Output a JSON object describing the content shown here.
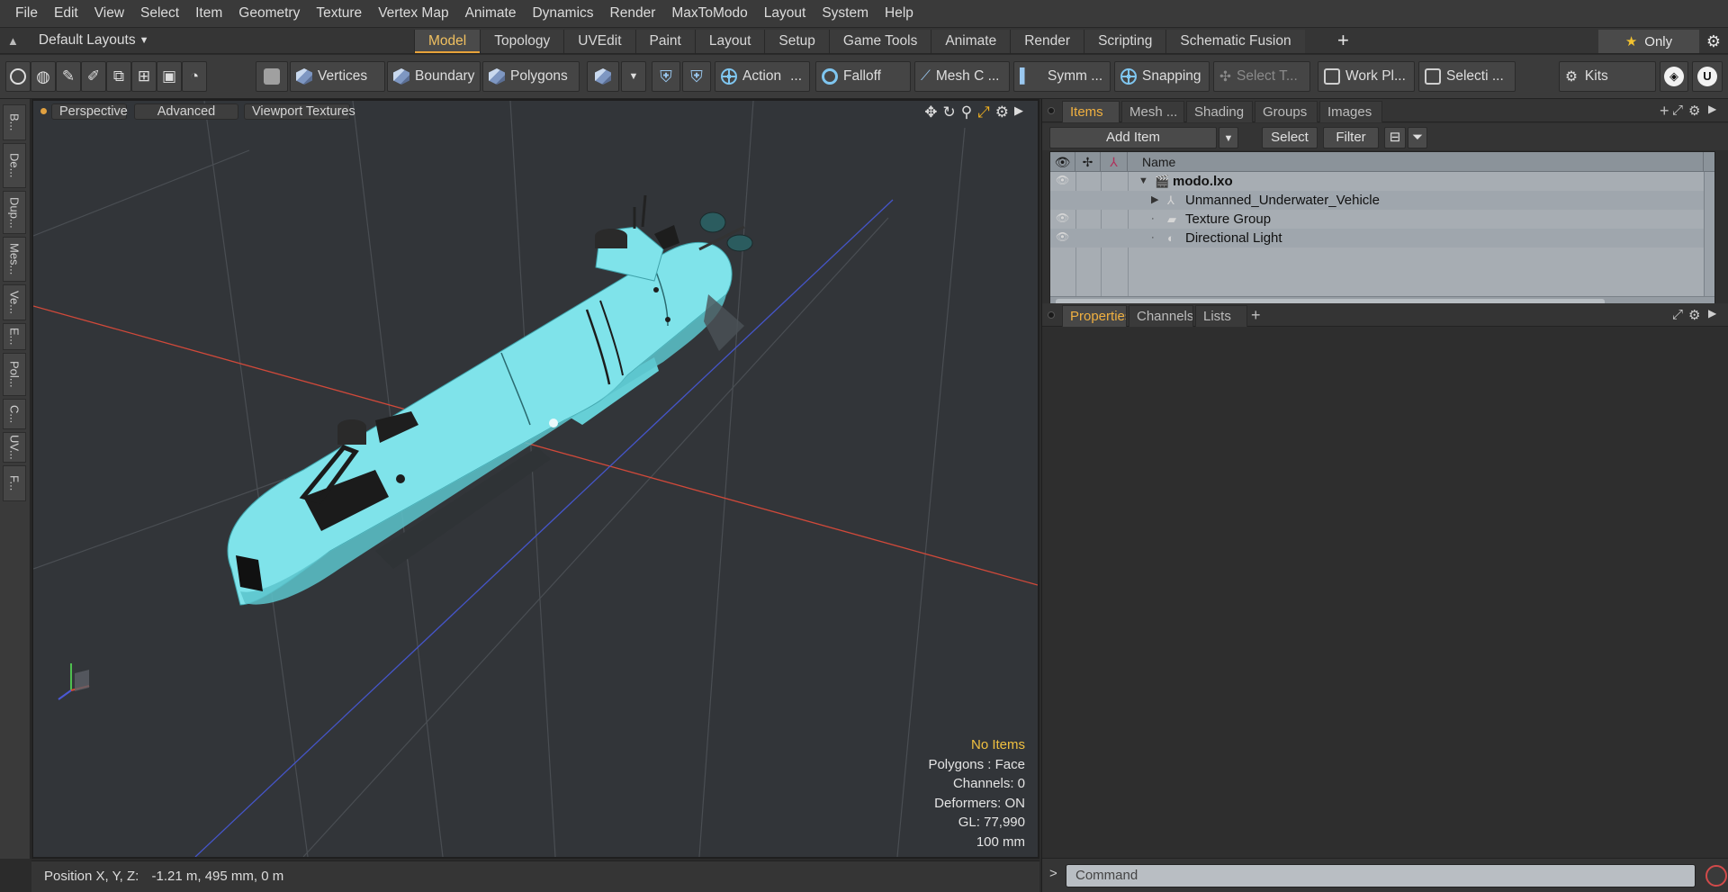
{
  "menu": [
    "File",
    "Edit",
    "View",
    "Select",
    "Item",
    "Geometry",
    "Texture",
    "Vertex Map",
    "Animate",
    "Dynamics",
    "Render",
    "MaxToModo",
    "Layout",
    "System",
    "Help"
  ],
  "layout": {
    "selector": "Default Layouts",
    "tabs": [
      "Model",
      "Topology",
      "UVEdit",
      "Paint",
      "Layout",
      "Setup",
      "Game Tools",
      "Animate",
      "Render",
      "Scripting",
      "Schematic Fusion"
    ],
    "active_tab": "Model",
    "only_label": "Only"
  },
  "toolbar": {
    "vertices": "Vertices",
    "boundary": "Boundary",
    "polygons": "Polygons",
    "action": "Action",
    "action_more": "...",
    "falloff": "Falloff",
    "mesh": "Mesh C ...",
    "symmetry": "Symm ...",
    "snapping": "Snapping",
    "select_tool": "Select T...",
    "work_plane": "Work Pl...",
    "selection": "Selecti ...",
    "kits": "Kits"
  },
  "left_strip": [
    "B...",
    "De...",
    "Dup...",
    "Mes...",
    "Ve...",
    "E...",
    "Pol...",
    "C...",
    "UV...",
    "F..."
  ],
  "viewport": {
    "view_mode": "Perspective",
    "shading": "Advanced",
    "textures": "Viewport Textures",
    "hud": {
      "selection": "No Items",
      "polygons": "Polygons : Face",
      "channels": "Channels: 0",
      "deformers": "Deformers: ON",
      "gl": "GL: 77,990",
      "grid": "100 mm"
    },
    "model_color": "#7fe3ea",
    "grid_x_axis_color": "#e0533f",
    "grid_z_axis_color": "#4a5ad0"
  },
  "status": {
    "label": "Position X, Y, Z:",
    "value": "-1.21 m, 495 mm, 0 m"
  },
  "items_panel": {
    "tabs": [
      "Items",
      "Mesh ...",
      "Shading",
      "Groups",
      "Images"
    ],
    "active_tab": "Items",
    "add_item": "Add Item",
    "select": "Select",
    "filter": "Filter",
    "column_name": "Name",
    "tree": [
      {
        "label": "modo.lxo",
        "level": 0,
        "bold": true,
        "visible": true,
        "icon": "scene-icon"
      },
      {
        "label": "Unmanned_Underwater_Vehicle",
        "level": 1,
        "bold": false,
        "visible": false,
        "icon": "mesh-locator-icon"
      },
      {
        "label": "Texture Group",
        "level": 1,
        "bold": false,
        "visible": true,
        "icon": "folder-icon"
      },
      {
        "label": "Directional Light",
        "level": 1,
        "bold": false,
        "visible": true,
        "icon": "light-icon"
      }
    ]
  },
  "properties_panel": {
    "tabs": [
      "Properties",
      "Channels",
      "Lists"
    ],
    "active_tab": "Properties"
  },
  "command": {
    "placeholder": "Command"
  }
}
